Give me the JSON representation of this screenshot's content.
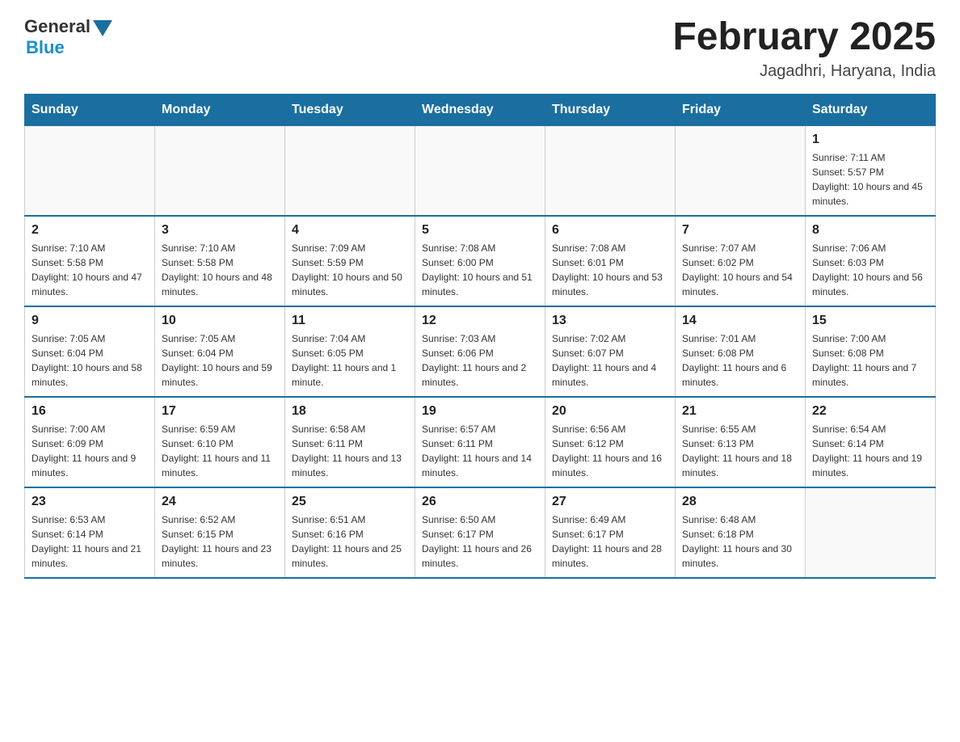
{
  "header": {
    "logo_general": "General",
    "logo_blue": "Blue",
    "month_title": "February 2025",
    "subtitle": "Jagadhri, Haryana, India"
  },
  "days_of_week": [
    "Sunday",
    "Monday",
    "Tuesday",
    "Wednesday",
    "Thursday",
    "Friday",
    "Saturday"
  ],
  "weeks": [
    [
      {
        "day": "",
        "info": ""
      },
      {
        "day": "",
        "info": ""
      },
      {
        "day": "",
        "info": ""
      },
      {
        "day": "",
        "info": ""
      },
      {
        "day": "",
        "info": ""
      },
      {
        "day": "",
        "info": ""
      },
      {
        "day": "1",
        "info": "Sunrise: 7:11 AM\nSunset: 5:57 PM\nDaylight: 10 hours and 45 minutes."
      }
    ],
    [
      {
        "day": "2",
        "info": "Sunrise: 7:10 AM\nSunset: 5:58 PM\nDaylight: 10 hours and 47 minutes."
      },
      {
        "day": "3",
        "info": "Sunrise: 7:10 AM\nSunset: 5:58 PM\nDaylight: 10 hours and 48 minutes."
      },
      {
        "day": "4",
        "info": "Sunrise: 7:09 AM\nSunset: 5:59 PM\nDaylight: 10 hours and 50 minutes."
      },
      {
        "day": "5",
        "info": "Sunrise: 7:08 AM\nSunset: 6:00 PM\nDaylight: 10 hours and 51 minutes."
      },
      {
        "day": "6",
        "info": "Sunrise: 7:08 AM\nSunset: 6:01 PM\nDaylight: 10 hours and 53 minutes."
      },
      {
        "day": "7",
        "info": "Sunrise: 7:07 AM\nSunset: 6:02 PM\nDaylight: 10 hours and 54 minutes."
      },
      {
        "day": "8",
        "info": "Sunrise: 7:06 AM\nSunset: 6:03 PM\nDaylight: 10 hours and 56 minutes."
      }
    ],
    [
      {
        "day": "9",
        "info": "Sunrise: 7:05 AM\nSunset: 6:04 PM\nDaylight: 10 hours and 58 minutes."
      },
      {
        "day": "10",
        "info": "Sunrise: 7:05 AM\nSunset: 6:04 PM\nDaylight: 10 hours and 59 minutes."
      },
      {
        "day": "11",
        "info": "Sunrise: 7:04 AM\nSunset: 6:05 PM\nDaylight: 11 hours and 1 minute."
      },
      {
        "day": "12",
        "info": "Sunrise: 7:03 AM\nSunset: 6:06 PM\nDaylight: 11 hours and 2 minutes."
      },
      {
        "day": "13",
        "info": "Sunrise: 7:02 AM\nSunset: 6:07 PM\nDaylight: 11 hours and 4 minutes."
      },
      {
        "day": "14",
        "info": "Sunrise: 7:01 AM\nSunset: 6:08 PM\nDaylight: 11 hours and 6 minutes."
      },
      {
        "day": "15",
        "info": "Sunrise: 7:00 AM\nSunset: 6:08 PM\nDaylight: 11 hours and 7 minutes."
      }
    ],
    [
      {
        "day": "16",
        "info": "Sunrise: 7:00 AM\nSunset: 6:09 PM\nDaylight: 11 hours and 9 minutes."
      },
      {
        "day": "17",
        "info": "Sunrise: 6:59 AM\nSunset: 6:10 PM\nDaylight: 11 hours and 11 minutes."
      },
      {
        "day": "18",
        "info": "Sunrise: 6:58 AM\nSunset: 6:11 PM\nDaylight: 11 hours and 13 minutes."
      },
      {
        "day": "19",
        "info": "Sunrise: 6:57 AM\nSunset: 6:11 PM\nDaylight: 11 hours and 14 minutes."
      },
      {
        "day": "20",
        "info": "Sunrise: 6:56 AM\nSunset: 6:12 PM\nDaylight: 11 hours and 16 minutes."
      },
      {
        "day": "21",
        "info": "Sunrise: 6:55 AM\nSunset: 6:13 PM\nDaylight: 11 hours and 18 minutes."
      },
      {
        "day": "22",
        "info": "Sunrise: 6:54 AM\nSunset: 6:14 PM\nDaylight: 11 hours and 19 minutes."
      }
    ],
    [
      {
        "day": "23",
        "info": "Sunrise: 6:53 AM\nSunset: 6:14 PM\nDaylight: 11 hours and 21 minutes."
      },
      {
        "day": "24",
        "info": "Sunrise: 6:52 AM\nSunset: 6:15 PM\nDaylight: 11 hours and 23 minutes."
      },
      {
        "day": "25",
        "info": "Sunrise: 6:51 AM\nSunset: 6:16 PM\nDaylight: 11 hours and 25 minutes."
      },
      {
        "day": "26",
        "info": "Sunrise: 6:50 AM\nSunset: 6:17 PM\nDaylight: 11 hours and 26 minutes."
      },
      {
        "day": "27",
        "info": "Sunrise: 6:49 AM\nSunset: 6:17 PM\nDaylight: 11 hours and 28 minutes."
      },
      {
        "day": "28",
        "info": "Sunrise: 6:48 AM\nSunset: 6:18 PM\nDaylight: 11 hours and 30 minutes."
      },
      {
        "day": "",
        "info": ""
      }
    ]
  ]
}
